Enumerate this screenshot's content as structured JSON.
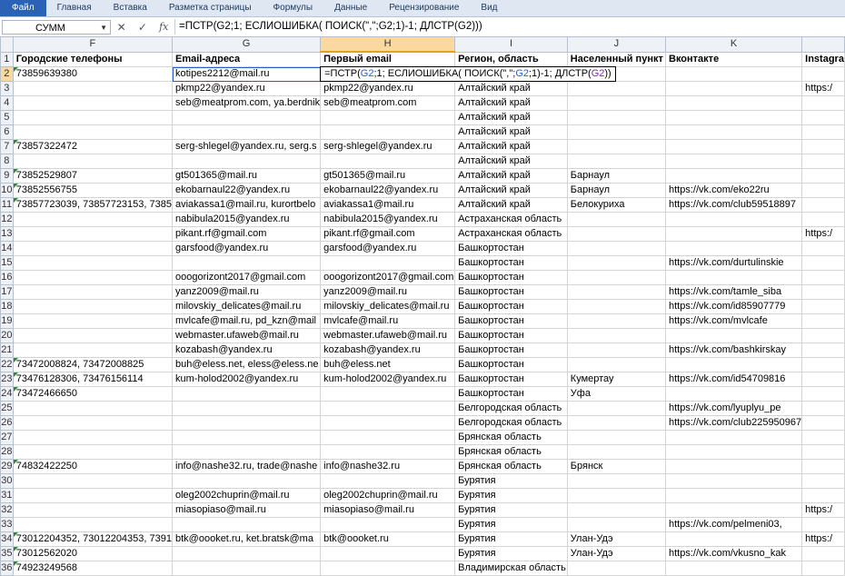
{
  "ribbon": {
    "tabs": [
      "Файл",
      "Главная",
      "Вставка",
      "Разметка страницы",
      "Формулы",
      "Данные",
      "Рецензирование",
      "Вид"
    ]
  },
  "formula_bar": {
    "name_box": "СУММ",
    "formula": "=ПСТР(G2;1; ЕСЛИОШИБКА( ПОИСК(\",\";G2;1)-1; ДЛСТР(G2)))"
  },
  "columns": [
    "F",
    "G",
    "H",
    "I",
    "J",
    "K",
    ""
  ],
  "header_row": [
    "Городские телефоны",
    "Email-адреса",
    "Первый email",
    "Регион, область",
    "Населенный пункт",
    "Вконтакте",
    "Instagra"
  ],
  "rows": [
    {
      "n": "3",
      "f": "",
      "g": "pkmp22@yandex.ru",
      "h": "pkmp22@yandex.ru",
      "i": "Алтайский край",
      "j": "",
      "k": "",
      "l": "https:/"
    },
    {
      "n": "4",
      "f": "",
      "g": "seb@meatprom.com, ya.berdnik",
      "h": "seb@meatprom.com",
      "i": "Алтайский край",
      "j": "",
      "k": "",
      "l": ""
    },
    {
      "n": "5",
      "f": "",
      "g": "",
      "h": "",
      "i": "Алтайский край",
      "j": "",
      "k": "",
      "l": ""
    },
    {
      "n": "6",
      "f": "",
      "g": "",
      "h": "",
      "i": "Алтайский край",
      "j": "",
      "k": "",
      "l": ""
    },
    {
      "n": "7",
      "f": "73857322472",
      "g": "serg-shlegel@yandex.ru, serg.s",
      "h": "serg-shlegel@yandex.ru",
      "i": "Алтайский край",
      "j": "",
      "k": "",
      "l": ""
    },
    {
      "n": "8",
      "f": "",
      "g": "",
      "h": "",
      "i": "Алтайский край",
      "j": "",
      "k": "",
      "l": ""
    },
    {
      "n": "9",
      "f": "73852529807",
      "g": "gt501365@mail.ru",
      "h": "gt501365@mail.ru",
      "i": "Алтайский край",
      "j": "Барнаул",
      "k": "",
      "l": ""
    },
    {
      "n": "10",
      "f": "73852556755",
      "g": "ekobarnaul22@yandex.ru",
      "h": "ekobarnaul22@yandex.ru",
      "i": "Алтайский край",
      "j": "Барнаул",
      "k": "https://vk.com/eko22ru",
      "l": ""
    },
    {
      "n": "11",
      "f": "73857723039, 73857723153, 7385",
      "g": "aviakassa1@mail.ru, kurortbelo",
      "h": "aviakassa1@mail.ru",
      "i": "Алтайский край",
      "j": "Белокуриха",
      "k": "https://vk.com/club59518897",
      "l": ""
    },
    {
      "n": "12",
      "f": "",
      "g": "nabibula2015@yandex.ru",
      "h": "nabibula2015@yandex.ru",
      "i": "Астраханская область",
      "j": "",
      "k": "",
      "l": ""
    },
    {
      "n": "13",
      "f": "",
      "g": "pikant.rf@gmail.com",
      "h": "pikant.rf@gmail.com",
      "i": "Астраханская область",
      "j": "",
      "k": "",
      "l": "https:/"
    },
    {
      "n": "14",
      "f": "",
      "g": "garsfood@yandex.ru",
      "h": "garsfood@yandex.ru",
      "i": "Башкортостан",
      "j": "",
      "k": "",
      "l": ""
    },
    {
      "n": "15",
      "f": "",
      "g": "",
      "h": "",
      "i": "Башкортостан",
      "j": "",
      "k": "https://vk.com/durtulinskie",
      "l": ""
    },
    {
      "n": "16",
      "f": "",
      "g": "ooogorizont2017@gmail.com",
      "h": "ooogorizont2017@gmail.com",
      "i": "Башкортостан",
      "j": "",
      "k": "",
      "l": ""
    },
    {
      "n": "17",
      "f": "",
      "g": "yanz2009@mail.ru",
      "h": "yanz2009@mail.ru",
      "i": "Башкортостан",
      "j": "",
      "k": "https://vk.com/tamle_siba",
      "l": ""
    },
    {
      "n": "18",
      "f": "",
      "g": "milovskiy_delicates@mail.ru",
      "h": "milovskiy_delicates@mail.ru",
      "i": "Башкортостан",
      "j": "",
      "k": "https://vk.com/id85907779",
      "l": ""
    },
    {
      "n": "19",
      "f": "",
      "g": "mvlcafe@mail.ru, pd_kzn@mail",
      "h": "mvlcafe@mail.ru",
      "i": "Башкортостан",
      "j": "",
      "k": "https://vk.com/mvlcafe",
      "l": ""
    },
    {
      "n": "20",
      "f": "",
      "g": "webmaster.ufaweb@mail.ru",
      "h": "webmaster.ufaweb@mail.ru",
      "i": "Башкортостан",
      "j": "",
      "k": "",
      "l": ""
    },
    {
      "n": "21",
      "f": "",
      "g": "kozabash@yandex.ru",
      "h": "kozabash@yandex.ru",
      "i": "Башкортостан",
      "j": "",
      "k": "https://vk.com/bashkirskay",
      "l": ""
    },
    {
      "n": "22",
      "f": "73472008824, 73472008825",
      "g": "buh@eless.net, eless@eless.ne",
      "h": "buh@eless.net",
      "i": "Башкортостан",
      "j": "",
      "k": "",
      "l": ""
    },
    {
      "n": "23",
      "f": "73476128306, 73476156114",
      "g": "kum-holod2002@yandex.ru",
      "h": "kum-holod2002@yandex.ru",
      "i": "Башкортостан",
      "j": "Кумертау",
      "k": "https://vk.com/id54709816",
      "l": ""
    },
    {
      "n": "24",
      "f": "73472466650",
      "g": "",
      "h": "",
      "i": "Башкортостан",
      "j": "Уфа",
      "k": "",
      "l": ""
    },
    {
      "n": "25",
      "f": "",
      "g": "",
      "h": "",
      "i": "Белгородская область",
      "j": "",
      "k": "https://vk.com/lyuplyu_pe",
      "l": ""
    },
    {
      "n": "26",
      "f": "",
      "g": "",
      "h": "",
      "i": "Белгородская область",
      "j": "",
      "k": "https://vk.com/club225950967",
      "l": ""
    },
    {
      "n": "27",
      "f": "",
      "g": "",
      "h": "",
      "i": "Брянская область",
      "j": "",
      "k": "",
      "l": ""
    },
    {
      "n": "28",
      "f": "",
      "g": "",
      "h": "",
      "i": "Брянская область",
      "j": "",
      "k": "",
      "l": ""
    },
    {
      "n": "29",
      "f": "74832422250",
      "g": "info@nashe32.ru, trade@nashe",
      "h": "info@nashe32.ru",
      "i": "Брянская область",
      "j": "Брянск",
      "k": "",
      "l": ""
    },
    {
      "n": "30",
      "f": "",
      "g": "",
      "h": "",
      "i": "Бурятия",
      "j": "",
      "k": "",
      "l": ""
    },
    {
      "n": "31",
      "f": "",
      "g": "oleg2002chuprin@mail.ru",
      "h": "oleg2002chuprin@mail.ru",
      "i": "Бурятия",
      "j": "",
      "k": "",
      "l": ""
    },
    {
      "n": "32",
      "f": "",
      "g": "miasopiaso@mail.ru",
      "h": "miasopiaso@mail.ru",
      "i": "Бурятия",
      "j": "",
      "k": "",
      "l": "https:/"
    },
    {
      "n": "33",
      "f": "",
      "g": "",
      "h": "",
      "i": "Бурятия",
      "j": "",
      "k": "https://vk.com/pelmeni03,",
      "l": ""
    },
    {
      "n": "34",
      "f": "73012204352, 73012204353, 7391",
      "g": "btk@oooket.ru, ket.bratsk@ma",
      "h": "btk@oooket.ru",
      "i": "Бурятия",
      "j": "Улан-Удэ",
      "k": "",
      "l": "https:/"
    },
    {
      "n": "35",
      "f": "73012562020",
      "g": "",
      "h": "",
      "i": "Бурятия",
      "j": "Улан-Удэ",
      "k": "https://vk.com/vkusno_kak",
      "l": ""
    },
    {
      "n": "36",
      "f": "74923249568",
      "g": "",
      "h": "",
      "i": "Владимирская область",
      "j": "",
      "k": "",
      "l": ""
    }
  ],
  "row2": {
    "n": "2",
    "f": "73859639380",
    "g": "kotipes2212@mail.ru",
    "l": "",
    "i": "",
    "j": "",
    "k": ""
  },
  "edit_formula": {
    "p1": "=ПСТР(",
    "r1": "G2",
    "p2": ";1; ЕСЛИОШИБКА( ПОИСК(\",\";",
    "r2": "G2",
    "p3": ";1)-1; ДЛСТР(",
    "r3": "G2",
    "p4": "))"
  },
  "row1_number": "1"
}
